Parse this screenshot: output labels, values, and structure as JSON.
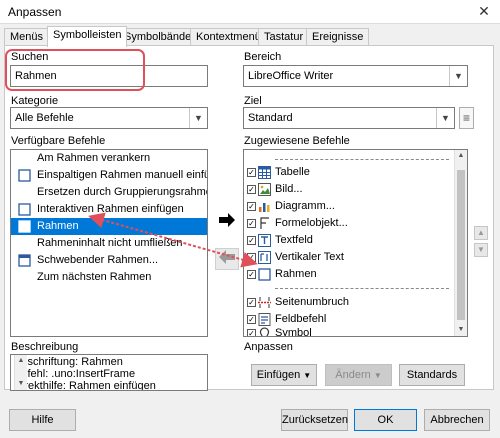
{
  "window": {
    "title": "Anpassen",
    "close_glyph": "✕"
  },
  "tabs": [
    "Menüs",
    "Symbolleisten",
    "Symbolbänder",
    "Kontextmenüs",
    "Tastatur",
    "Ereignisse"
  ],
  "search": {
    "label": "Suchen",
    "value": "Rahmen"
  },
  "category": {
    "label": "Kategorie",
    "value": "Alle Befehle"
  },
  "available": {
    "label": "Verfügbare Befehle",
    "items": [
      {
        "label": "Am Rahmen verankern",
        "icon": "none"
      },
      {
        "label": "Einspaltigen Rahmen manuell einfügen",
        "icon": "frame-icon"
      },
      {
        "label": "Ersetzen durch Gruppierungsrahmen",
        "icon": "none"
      },
      {
        "label": "Interaktiven Rahmen einfügen",
        "icon": "frame-icon"
      },
      {
        "label": "Rahmen",
        "icon": "frame-icon"
      },
      {
        "label": "Rahmeninhalt nicht umfließen",
        "icon": "none"
      },
      {
        "label": "Schwebender Rahmen...",
        "icon": "floating-frame-icon"
      },
      {
        "label": "Zum nächsten Rahmen",
        "icon": "none"
      }
    ]
  },
  "scope": {
    "label": "Bereich",
    "value": "LibreOffice Writer"
  },
  "target": {
    "label": "Ziel",
    "value": "Standard",
    "menu_glyph": "≡"
  },
  "assigned": {
    "label": "Zugewiesene Befehle",
    "items": [
      {
        "label": "",
        "separator": true
      },
      {
        "label": "Tabelle",
        "icon": "table-icon"
      },
      {
        "label": "Bild...",
        "icon": "image-icon"
      },
      {
        "label": "Diagramm...",
        "icon": "chart-icon"
      },
      {
        "label": "Formelobjekt...",
        "icon": "formula-icon"
      },
      {
        "label": "Textfeld",
        "icon": "textbox-icon"
      },
      {
        "label": "Vertikaler Text",
        "icon": "vertical-text-icon"
      },
      {
        "label": "Rahmen",
        "icon": "frame-icon"
      },
      {
        "label": "",
        "separator": true
      },
      {
        "label": "Seitenumbruch",
        "icon": "page-break-icon"
      },
      {
        "label": "Feldbefehl",
        "icon": "field-icon"
      },
      {
        "label": "Symbol",
        "icon": "symbol-icon"
      }
    ]
  },
  "description": {
    "label": "Beschreibung",
    "lines": [
      "Beschriftung: Rahmen",
      "Befehl: .uno:InsertFrame",
      "Direkthilfe: Rahmen einfügen"
    ]
  },
  "customize": {
    "label": "Anpassen",
    "insert_button": "Einfügen",
    "modify_button": "Ändern",
    "defaults_button": "Standards"
  },
  "footer": {
    "help": "Hilfe",
    "reset": "Zurücksetzen",
    "ok": "OK",
    "cancel": "Abbrechen"
  },
  "colors": {
    "selection": "#0078d7",
    "annotation_red": "#e0505a"
  }
}
